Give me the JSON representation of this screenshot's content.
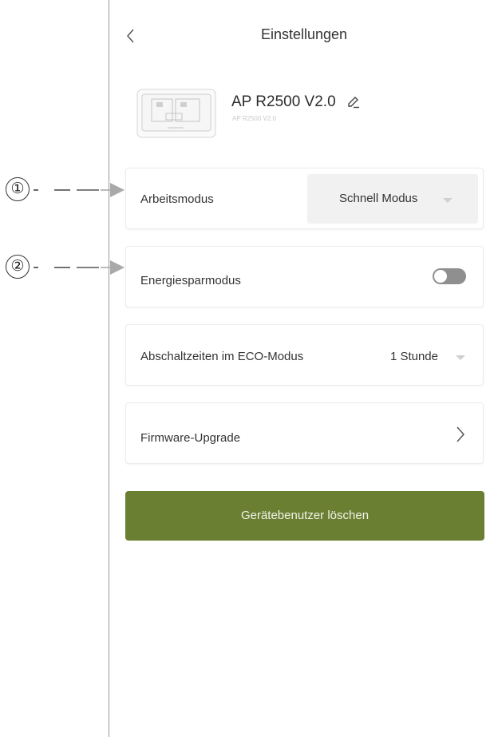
{
  "header": {
    "title": "Einstellungen",
    "back_icon": "chevron-left-icon"
  },
  "device": {
    "name": "AP R2500 V2.0",
    "model_subtitle": "AP R2500 V2.0",
    "edit_icon": "pencil-icon"
  },
  "settings": {
    "work_mode": {
      "label": "Arbeitsmodus",
      "value": "Schnell Modus"
    },
    "energy_saving": {
      "label": "Energiesparmodus",
      "enabled": false
    },
    "eco_shutdown": {
      "label": "Abschaltzeiten im ECO-Modus",
      "value": "1 Stunde"
    },
    "firmware": {
      "label": "Firmware-Upgrade"
    }
  },
  "delete_button": {
    "label": "Gerätebenutzer löschen",
    "color": "#6b7f33"
  },
  "callouts": [
    {
      "number": "①",
      "suffix": "-"
    },
    {
      "number": "②",
      "suffix": "-"
    }
  ]
}
